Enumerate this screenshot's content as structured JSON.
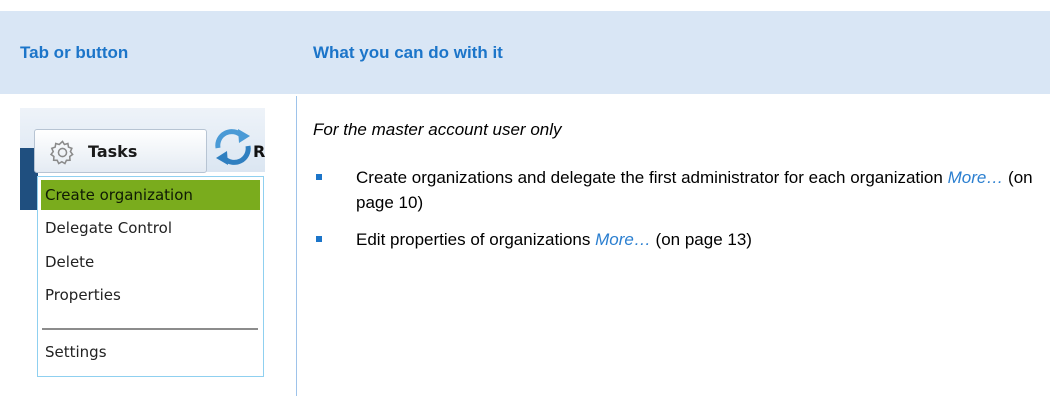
{
  "header": {
    "col1": "Tab or button",
    "col2": "What you can do with it"
  },
  "toolbar": {
    "tasks_label": "Tasks",
    "gear_icon": "gear-icon",
    "refresh_icon": "refresh-icon",
    "clipped_text": "R"
  },
  "menu": {
    "items": [
      {
        "label": "Create organization",
        "selected": true
      },
      {
        "label": "Delegate Control",
        "selected": false
      },
      {
        "label": "Delete",
        "selected": false
      },
      {
        "label": "Properties",
        "selected": false
      },
      {
        "label": "Settings",
        "selected": false
      }
    ],
    "selected_color": "#7aac1d",
    "border_color": "#8fd0f0"
  },
  "description": {
    "intro": "For the master account user only",
    "bullets": [
      {
        "text_before": "Create organizations and delegate the first administrator for each organization ",
        "link": "More…",
        "text_after": " (on page 10)"
      },
      {
        "text_before": "Edit properties of organizations ",
        "link": "More…",
        "text_after": " (on page 13)"
      }
    ]
  },
  "colors": {
    "header_bg": "#d9e6f5",
    "header_text": "#1c75c9",
    "bullet": "#1c75c9",
    "link": "#2b7fd0"
  }
}
